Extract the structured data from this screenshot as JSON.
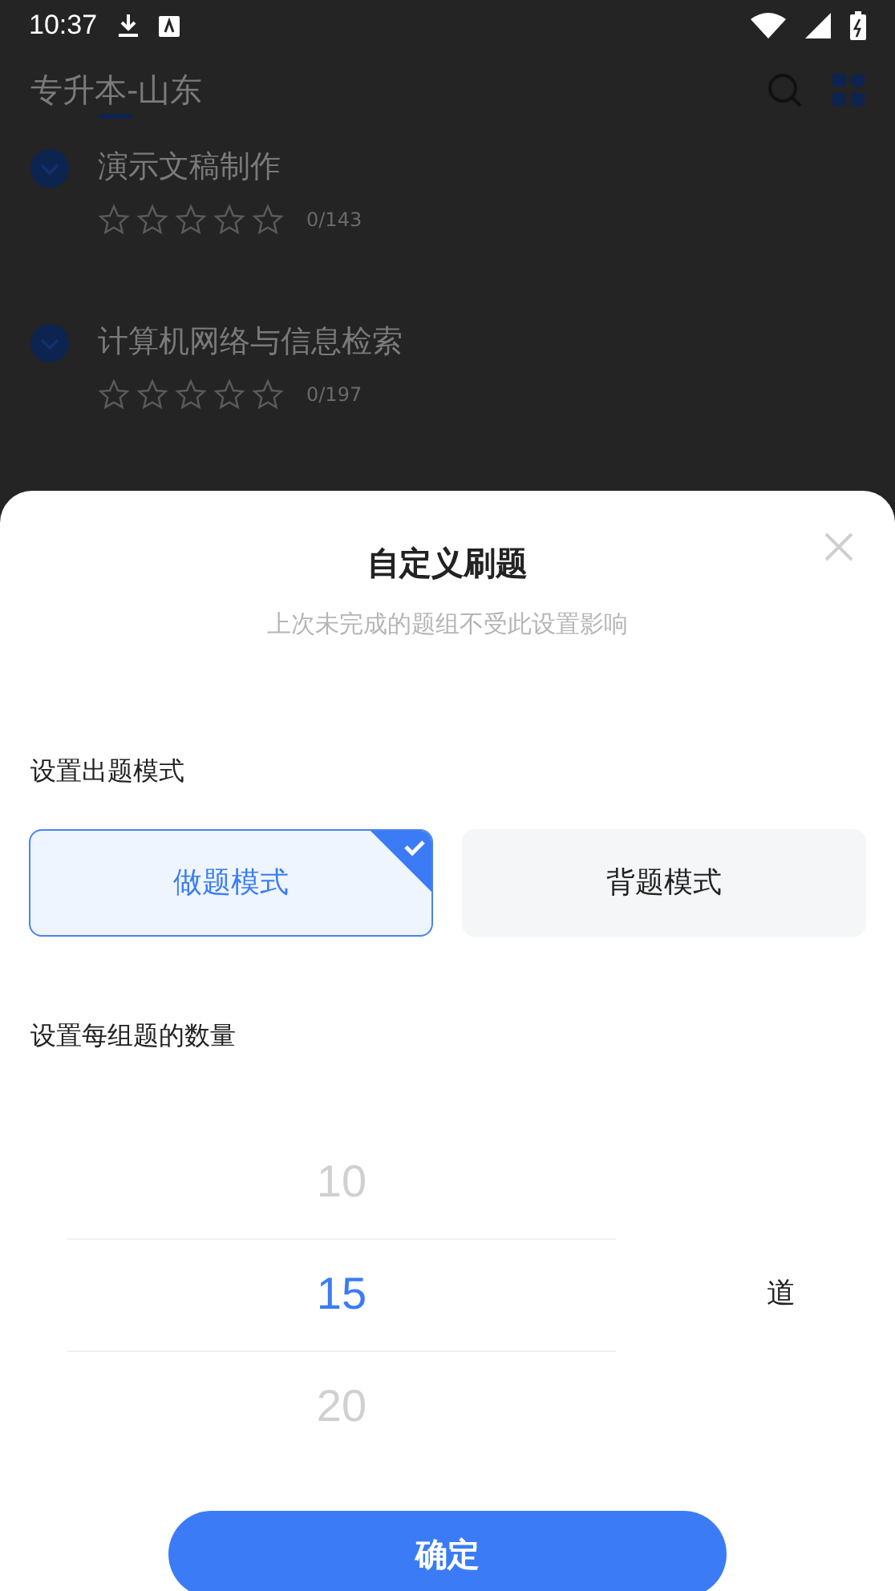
{
  "status_bar": {
    "time": "10:37"
  },
  "header": {
    "title": "专升本-山东"
  },
  "chapters": [
    {
      "title": "演示文稿制作",
      "stars": 0,
      "progress": "0/143"
    },
    {
      "title": "计算机网络与信息检索",
      "stars": 0,
      "progress": "0/197"
    }
  ],
  "dialog": {
    "title": "自定义刷题",
    "subtitle": "上次未完成的题组不受此设置影响",
    "mode_label": "设置出题模式",
    "modes": [
      {
        "label": "做题模式",
        "selected": true
      },
      {
        "label": "背题模式",
        "selected": false
      }
    ],
    "count_label": "设置每组题的数量",
    "counts": [
      {
        "value": "10",
        "selected": false
      },
      {
        "value": "15",
        "selected": true
      },
      {
        "value": "20",
        "selected": false
      }
    ],
    "unit": "道",
    "confirm": "确定"
  }
}
